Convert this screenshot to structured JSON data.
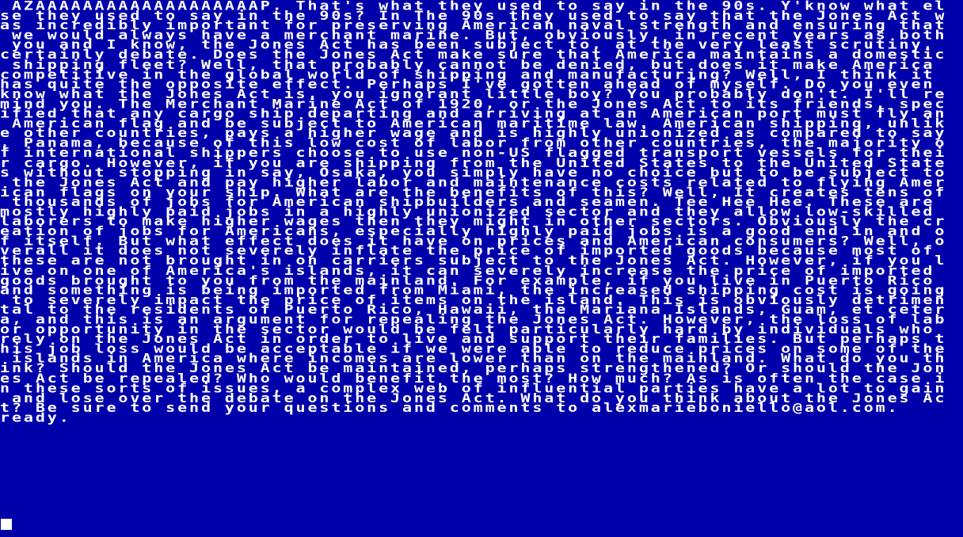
{
  "terminal": {
    "lines": [
      " AZAAAAAAAAAAAAAAAAAAAP. That's what they used to say in the 90s. Y'know what el",
      "se they used to say in the 90s? In The 90s they used to say that the Jones Act w",
      "as incredibly important for preserving American naval strength and ensuring that",
      " we would always have a merchant marine. But, obviously, in recent years as both",
      " you and I know, the Jones Act has been subject to, at the very least scrutiny, ",
      "certainly debate. Does the Jones Act make sure that America maintains a domestic",
      " shipping fleet? Well, that probably cannot be denied, but does it make America ",
      "competitive in the global world of shipping and manufacturing? Well, I think it ",
      "has quite the opposite effect. Perhaps I've gotten ahead of myself. Do you even ",
      "know what the Jones Act is, you ignorant little boy? You probably don't. I'll re",
      "mind you. The Merchant Marine Act of 1920, or the Jones Act to its friends, spec",
      "ified that any cargo ship departing and arriving at an American port must fly an",
      " American flag and be subject to American maritime law. American shipping, unlik",
      "e other countries, pays a higher wage and is highly unionized as compared to say",
      ", Panama, because of this low cost of labor from other countries, the majority o",
      "f international shippers choose to use non-US flagged transport vessels for thei",
      "r cargo. However, if you are shipping from the United States to the United State",
      "s without stopping in say, Osaka, you simply have no choice but to be subject to",
      " the Jones Act and pay higher labor and maintenance costs related to flying Amer",
      "ican flags on your ship. What are the benefits of this? Well, It creates tens of",
      " thousands of jobs for American shipbuilders and seamen. Tee Hee Hee. These are ",
      "mostly highly paid jobs in a highly unionized sector and they allow low-skilled ",
      "laborers to make higher wages then they might in other sectors. Obviously the cr",
      "eation of jobs for Americans, especially highly paid jobs is a good end in and o",
      "f itself. But what effect does it have on prices and American consumers? Well, o",
      "verall it does not severely inflate the price of imported goods because most of ",
      "these are not brought in on carriers subject to the Jones Act. However, if you l",
      "ive on one of America's islands, it can severely increase the price of imported ",
      "goods brought to you from the mainland. For example, if you live in Puerto Rico ",
      "and something is being imported from Miami, the increased shipping cost is going",
      " to severely impact the price of items on the island. This is obviously detrimen",
      "tal to the residents of Puerto Rico, Hawaii, the Mariana Islands, Guam, et ceter",
      "a, and this is an argument for repealing the Jones Act. However, the loss of lab",
      "or opportunity in the sector would be felt particularly hard by individuals who ",
      "rely on the Jones Act in order to live and support their families. But perhaps t",
      "his job loss would be acceptable if we were able to reduce prices on some of the",
      " islands in America where incomes are lower than on the mainland. What do you th",
      "ink? Should the Jones Act be maintained, perhaps strengthened? Or should the Jon",
      "es Act be repealed? Who would benefit the most? How much? As is often the case i",
      "n these sorts of issues, a complex web of influential parties have a lot to gain",
      " and lose over the debate on the Jones Act. What do you think about the Jones Ac",
      "t? Be sure to send your questions and comments to alexmarieboniello@aol.com.",
      "ready."
    ]
  },
  "colors": {
    "background": "#0000aa",
    "foreground": "#ffffff"
  },
  "cursor": {
    "icon": "block-cursor-icon"
  }
}
